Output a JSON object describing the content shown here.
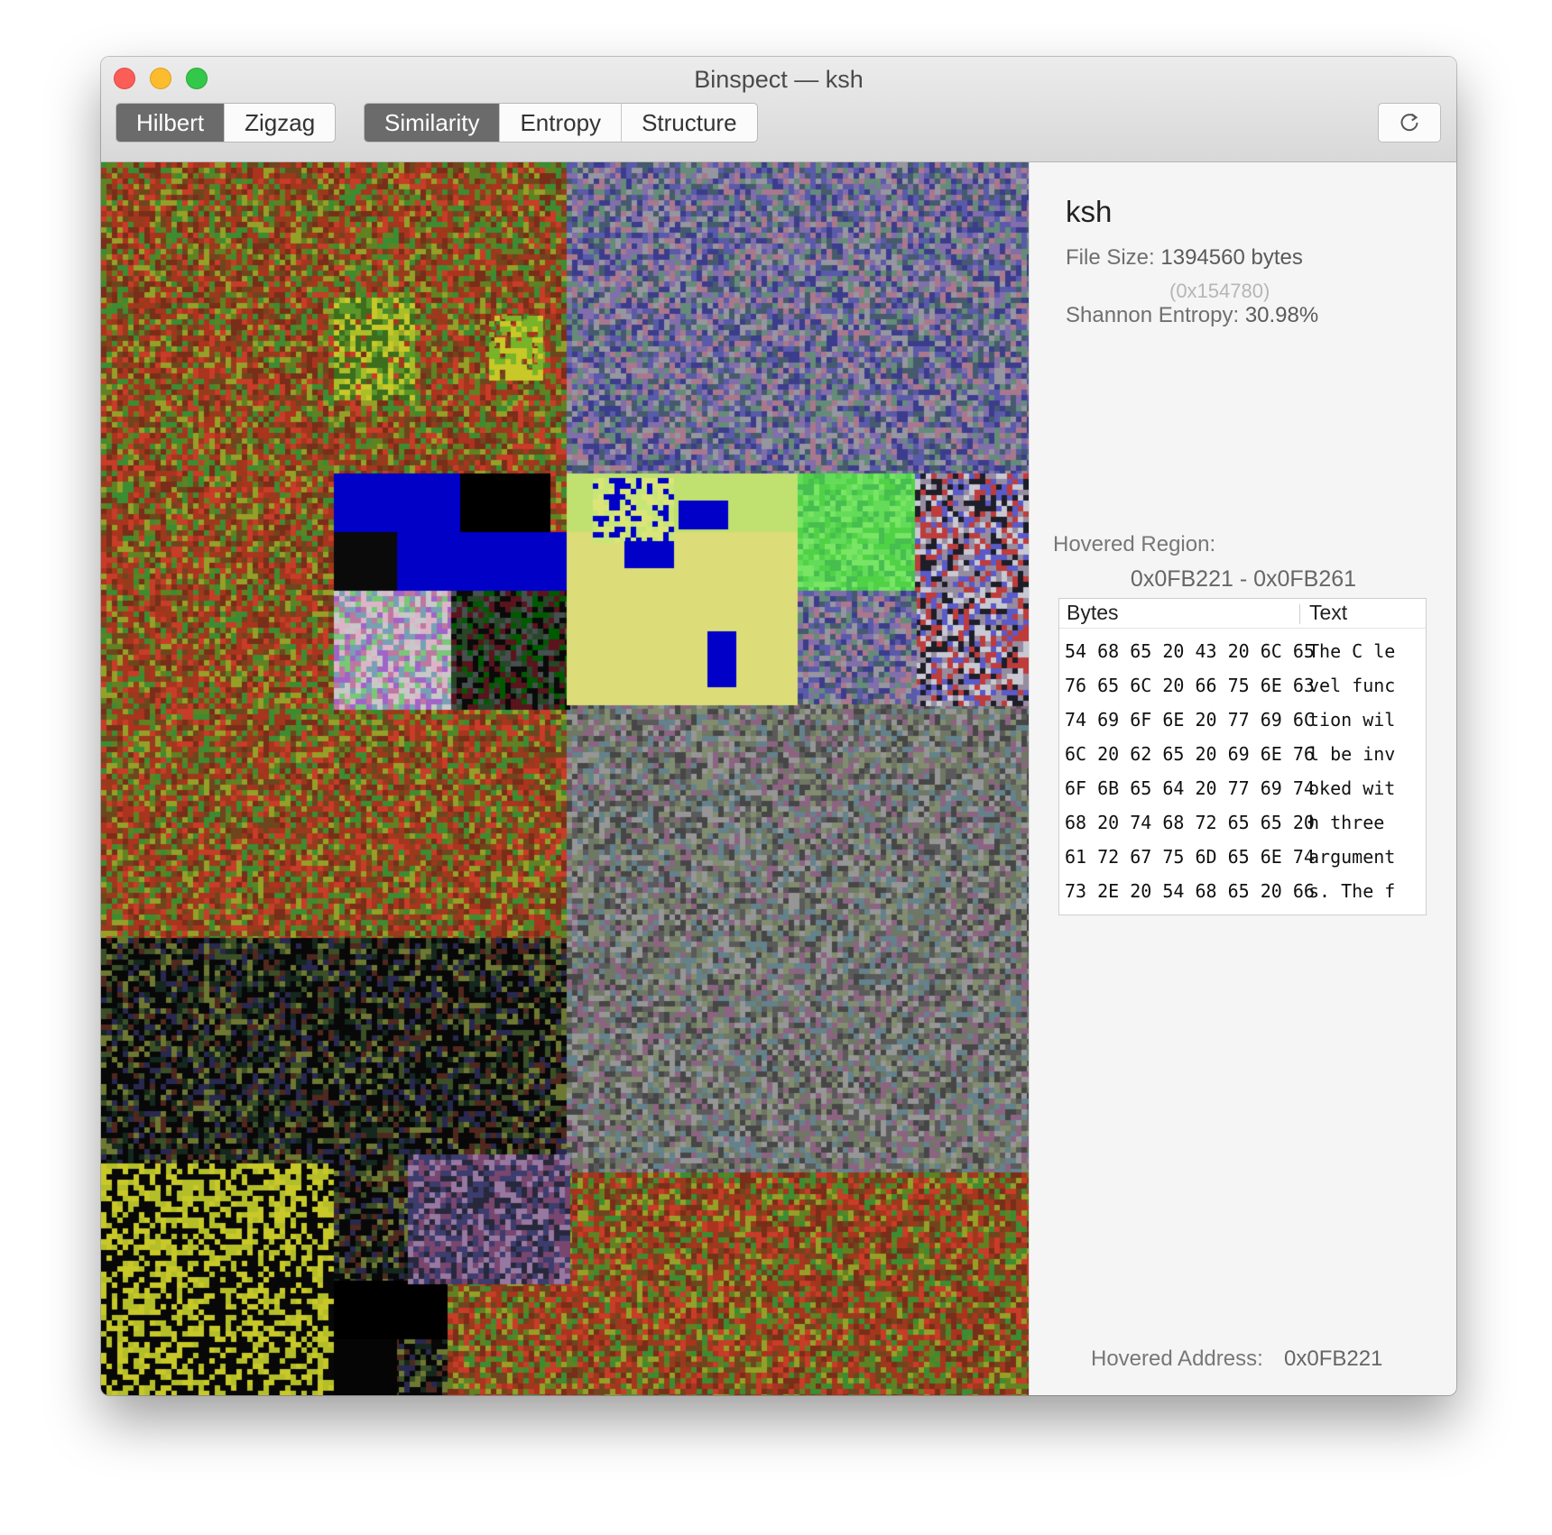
{
  "window": {
    "title": "Binspect — ksh"
  },
  "toolbar": {
    "curve_modes": [
      {
        "label": "Hilbert",
        "active": true
      },
      {
        "label": "Zigzag",
        "active": false
      }
    ],
    "color_modes": [
      {
        "label": "Similarity",
        "active": true
      },
      {
        "label": "Entropy",
        "active": false
      },
      {
        "label": "Structure",
        "active": false
      }
    ],
    "refresh_icon": "refresh-icon"
  },
  "panel": {
    "file_name": "ksh",
    "file_size_label": "File Size:",
    "file_size_value": "1394560 bytes",
    "file_size_hex": "(0x154780)",
    "entropy_label": "Shannon Entropy:",
    "entropy_value": "30.98%",
    "hovered_region_label": "Hovered Region:",
    "hovered_region_range": "0x0FB221 - 0x0FB261",
    "table": {
      "columns": [
        "Bytes",
        "Text"
      ],
      "rows": [
        {
          "bytes": "54 68 65 20 43 20 6C 65",
          "text": "The C le"
        },
        {
          "bytes": "76 65 6C 20 66 75 6E 63",
          "text": "vel func"
        },
        {
          "bytes": "74 69 6F 6E 20 77 69 6C",
          "text": "tion wil"
        },
        {
          "bytes": "6C 20 62 65 20 69 6E 76",
          "text": "l be inv"
        },
        {
          "bytes": "6F 6B 65 64 20 77 69 74",
          "text": "oked wit"
        },
        {
          "bytes": "68 20 74 68 72 65 65 20",
          "text": "h three"
        },
        {
          "bytes": "61 72 67 75 6D 65 6E 74",
          "text": "argument"
        },
        {
          "bytes": "73 2E 20 54 68 65 20 66",
          "text": "s. The f"
        }
      ]
    },
    "hovered_address_label": "Hovered Address:",
    "hovered_address_value": "0x0FB221"
  },
  "colors": {
    "accent_active": "#6b6b6b",
    "viz_red": "#9a3a1c",
    "viz_blue": "#0000c8",
    "viz_yellow": "#dcde78",
    "viz_green": "#55d24a"
  }
}
